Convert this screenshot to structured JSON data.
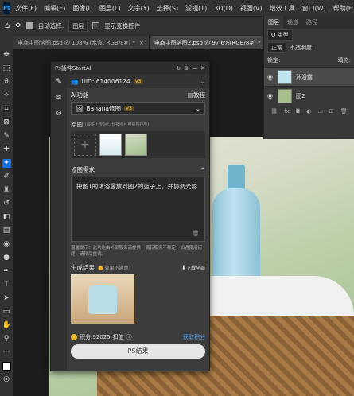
{
  "menubar": {
    "logo": "Ps",
    "items": [
      "文件(F)",
      "编辑(E)",
      "图像(I)",
      "图层(L)",
      "文字(Y)",
      "选择(S)",
      "滤镜(T)",
      "3D(D)",
      "视图(V)",
      "增效工具",
      "窗口(W)",
      "帮助(H)"
    ]
  },
  "options": {
    "autoselect": "自动选择:",
    "target": "图层",
    "transform": "显示变换控件"
  },
  "tabs": [
    {
      "label": "电商主图溶图.psd @ 108% (水盒, RGB/8#) *"
    },
    {
      "label": "电商主图溶图2.psd @ 97.6%(RGB/8#) *"
    }
  ],
  "layers_panel": {
    "tabs": [
      "图层",
      "通道",
      "路径"
    ],
    "kind_label": "Q 类型",
    "blend_mode": "正常",
    "opacity_label": "不透明度:",
    "lock_label": "锁定:",
    "fill_label": "填充:",
    "layers": [
      {
        "name": "沐浴露"
      },
      {
        "name": "图2"
      }
    ]
  },
  "plugin": {
    "title": "Ps插件StartAI",
    "uid": "UID: 614006124",
    "vip": "V3",
    "ai_section": "AI功能",
    "tutorial": "教程",
    "model": "Banana修图",
    "model_badge": "V3",
    "source_label": "原图",
    "source_hint": "(最多上传5张, 长按图片可拖拽排序)",
    "requirement_label": "修图需求",
    "prompt": "把图1的沐浴露放到图2的篮子上，并协调光影",
    "notice": "温馨提示：此功能由外部服务商提供，偶有服务不稳定，如遇使用问题，请稍后重试。",
    "result_label": "生成结果",
    "dissatisfied": "效果不满意?",
    "download_all": "下载全部",
    "points": "积分:92025",
    "points_unit": "扣值",
    "get_points": "获取积分",
    "generate": "PS结果"
  }
}
